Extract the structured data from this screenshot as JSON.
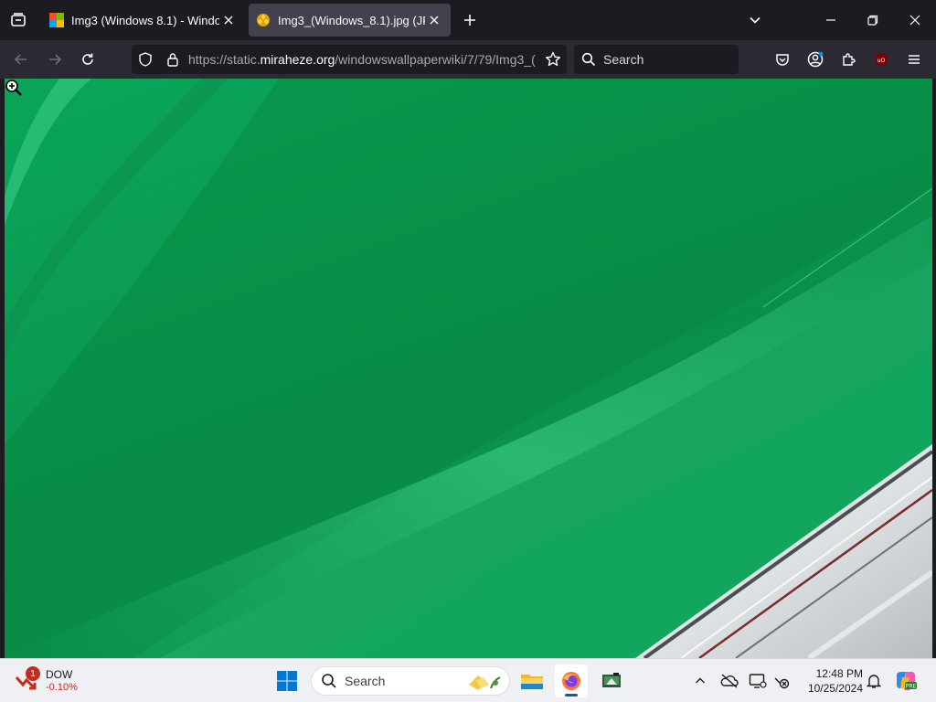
{
  "browser": {
    "tabs": [
      {
        "title": "Img3 (Windows 8.1) - Windows",
        "favicon": "wiki-favicon-icon",
        "active": false
      },
      {
        "title": "Img3_(Windows_8.1).jpg (JPEG I",
        "favicon": "image-favicon-icon",
        "active": true
      }
    ],
    "url": {
      "scheme": "https://static.",
      "host": "miraheze.org",
      "path": "/windowswallpaperwiki/7/79/Img3_("
    },
    "search_placeholder": "Search",
    "colors": {
      "tabstrip": "#1c1b22",
      "toolbar": "#2b2a33",
      "active_tab": "#42414d",
      "text": "#fbfbfe"
    }
  },
  "page": {
    "image_description_colors": {
      "green": "#0b9c52",
      "chrome": "#c9ccd0"
    }
  },
  "taskbar": {
    "widget": {
      "name": "DOW",
      "value": "-0.10%",
      "badge": "1"
    },
    "search_placeholder": "Search",
    "clock": {
      "time": "12:48 PM",
      "date": "10/25/2024"
    },
    "pinned": [
      "start-icon",
      "search",
      "file-explorer-icon",
      "firefox-icon",
      "app-icon"
    ],
    "tray": [
      "chevron-up-icon",
      "onedrive-icon",
      "display-icon",
      "network-icon",
      "notification-bell-icon",
      "copilot-icon"
    ]
  }
}
